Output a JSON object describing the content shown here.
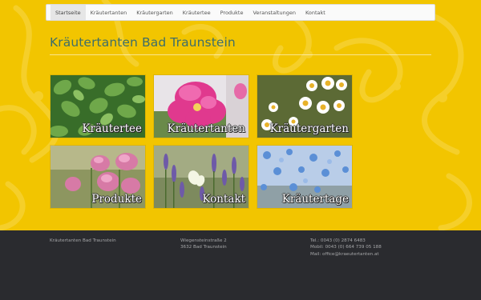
{
  "nav": {
    "items": [
      {
        "label": "Startseite",
        "active": true
      },
      {
        "label": "Kräutertanten",
        "active": false
      },
      {
        "label": "Kräutergarten",
        "active": false
      },
      {
        "label": "Kräutertee",
        "active": false
      },
      {
        "label": "Produkte",
        "active": false
      },
      {
        "label": "Veranstaltungen",
        "active": false
      },
      {
        "label": "Kontakt",
        "active": false
      }
    ]
  },
  "header": {
    "title": "Kräutertanten Bad Traunstein"
  },
  "tiles": [
    {
      "label": "Kräutertee",
      "image": "mint-leaves"
    },
    {
      "label": "Kräutertanten",
      "image": "pink-flower"
    },
    {
      "label": "Kräutergarten",
      "image": "chamomile-flowers"
    },
    {
      "label": "Produkte",
      "image": "mallow-flowers"
    },
    {
      "label": "Kontakt",
      "image": "lavender-butterfly"
    },
    {
      "label": "Kräutertage",
      "image": "blue-flax-flowers"
    }
  ],
  "footer": {
    "name": "Kräutertanten Bad Traunstein",
    "street": "Wiegensteinstraße 2",
    "city": "3632 Bad Traunstein",
    "phone": "Tel.: 0043 (0) 2874 6483",
    "mobile": "Mobil: 0043 (0) 664 739 05 188",
    "mail": "Mail: office@kraeutertanten.at"
  },
  "colors": {
    "background": "#f2c500",
    "title": "#3d6e6a",
    "footer": "#2a2b2f"
  }
}
